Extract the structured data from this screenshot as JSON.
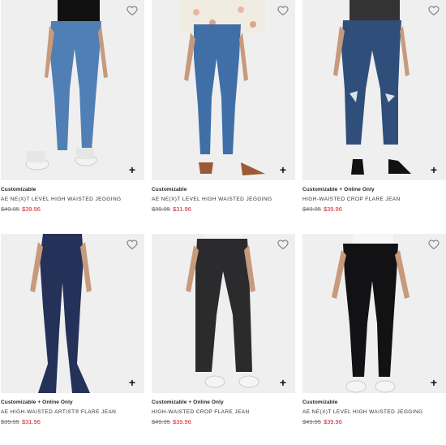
{
  "products": [
    {
      "badge": "Customizable",
      "name": "AE Ne(x)t Level High Waisted Jegging",
      "old_price": "$49.95",
      "sale_price": "$39.96",
      "denim_color": "#4f7fb4"
    },
    {
      "badge": "Customizable",
      "name": "AE Ne(x)t Level High Waisted Jegging",
      "old_price": "$39.95",
      "sale_price": "$31.96",
      "denim_color": "#3f6fa6"
    },
    {
      "badge": "Customizable + Online Only",
      "name": "High-Waisted Crop Flare Jean",
      "old_price": "$49.95",
      "sale_price": "$39.96",
      "denim_color": "#2f4e7a"
    },
    {
      "badge": "Customizable + Online Only",
      "name": "AE High-Waisted Artist® Flare Jean",
      "old_price": "$39.95",
      "sale_price": "$31.96",
      "denim_color": "#243159"
    },
    {
      "badge": "Customizable + Online Only",
      "name": "High-Waisted Crop Flare Jean",
      "old_price": "$49.95",
      "sale_price": "$39.96",
      "denim_color": "#2b2b2e"
    },
    {
      "badge": "Customizable",
      "name": "AE Ne(x)t Level High Waisted Jegging",
      "old_price": "$49.95",
      "sale_price": "$39.96",
      "denim_color": "#121214"
    }
  ],
  "icons": {
    "wishlist": "heart-outline-icon",
    "add": "plus-icon"
  },
  "colors": {
    "sale": "#d6202a",
    "strike": "#777777"
  }
}
